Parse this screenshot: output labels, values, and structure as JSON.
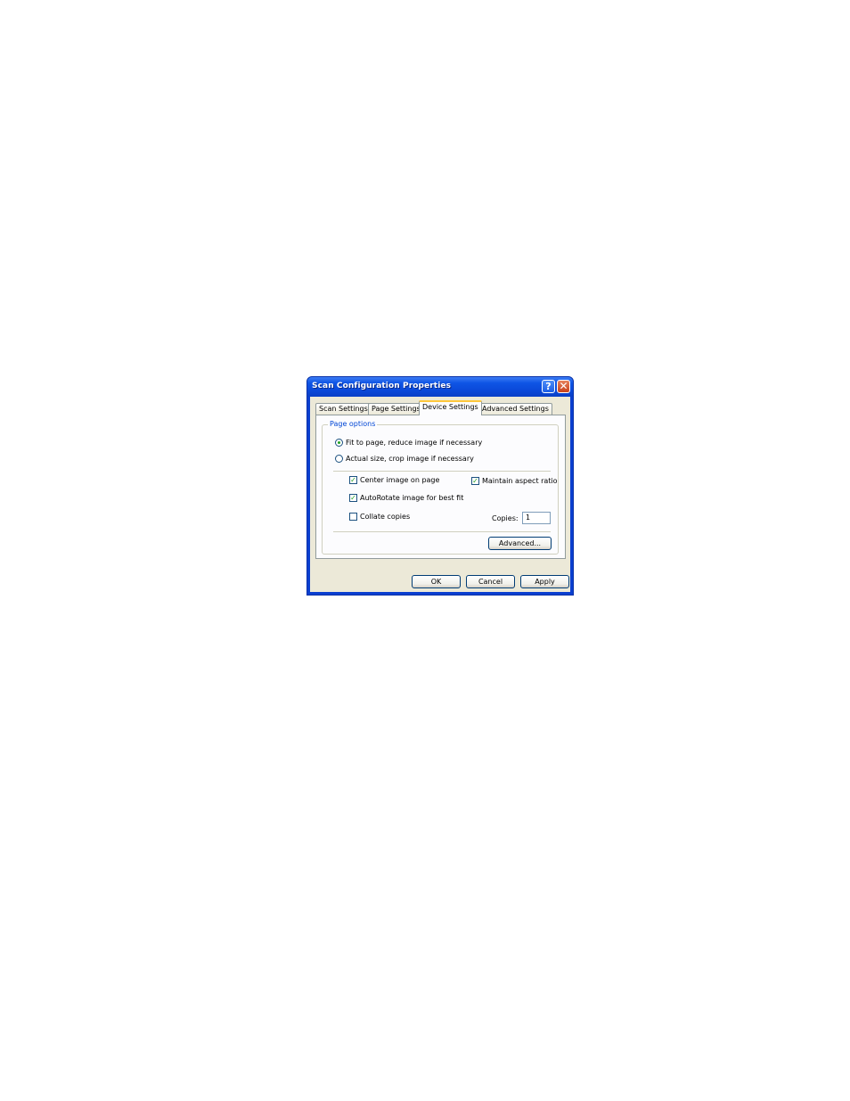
{
  "window": {
    "title": "Scan Configuration Properties",
    "help_glyph": "?",
    "close_glyph": "✕"
  },
  "tabs": [
    {
      "label": "Scan Settings",
      "active": false
    },
    {
      "label": "Page Settings",
      "active": false
    },
    {
      "label": "Device Settings",
      "active": true
    },
    {
      "label": "Advanced Settings",
      "active": false
    }
  ],
  "page_options": {
    "group_label": "Page options",
    "radio_fit": {
      "label": "Fit to page, reduce image if necessary",
      "selected": true
    },
    "radio_actual": {
      "label": "Actual size, crop image if necessary",
      "selected": false
    },
    "center_image": {
      "label": "Center image on page",
      "checked": true
    },
    "maintain_aspect": {
      "label": "Maintain aspect ratio",
      "checked": true
    },
    "autorotate": {
      "label": "AutoRotate image for best fit",
      "checked": true
    },
    "collate": {
      "label": "Collate copies",
      "checked": false
    },
    "copies_label": "Copies:",
    "copies_value": "1",
    "advanced_button": "Advanced..."
  },
  "buttons": {
    "ok": "OK",
    "cancel": "Cancel",
    "apply": "Apply"
  },
  "check_glyph": "✓",
  "colors": {
    "title_bar": "#0a48d8",
    "group_label": "#0046d5",
    "active_tab_accent": "#ffc83c",
    "checkmark": "#21a121"
  }
}
